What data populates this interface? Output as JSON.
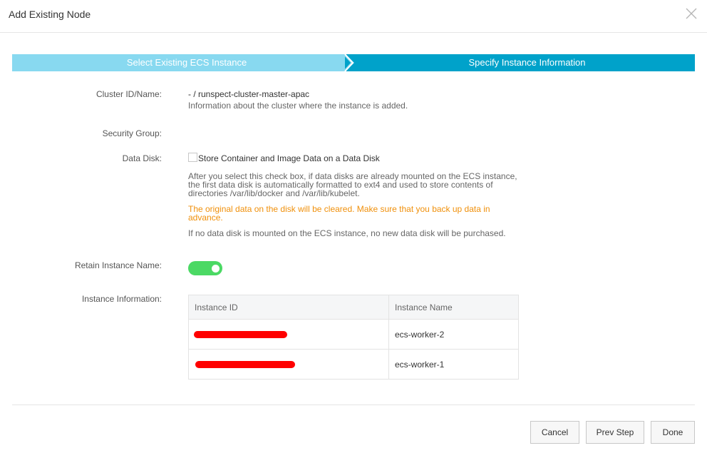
{
  "dialog": {
    "title": "Add Existing Node",
    "close_icon": "close-icon"
  },
  "steps": [
    {
      "label": "Select Existing ECS Instance",
      "state": "done"
    },
    {
      "label": "Specify Instance Information",
      "state": "active"
    }
  ],
  "form": {
    "cluster": {
      "label": "Cluster ID/Name:",
      "value": "- / runspect-cluster-master-apac",
      "description": "Information about the cluster where the instance is added."
    },
    "security_group": {
      "label": "Security Group:"
    },
    "data_disk": {
      "label": "Data Disk:",
      "checkbox_label": "Store Container and Image Data on a Data Disk",
      "checked": false,
      "help_line1": "After you select this check box, if data disks are already mounted on the ECS instance,",
      "help_line2": "the first data disk is automatically formatted to ext4 and used to store contents of",
      "help_line3": "directories /var/lib/docker and /var/lib/kubelet.",
      "warning_line1": "The original data on the disk will be cleared. Make sure that you back up data in",
      "warning_line2": "advance.",
      "note": "If no data disk is mounted on the ECS instance, no new data disk will be purchased."
    },
    "retain_name": {
      "label": "Retain Instance Name:",
      "enabled": true
    },
    "instances": {
      "label": "Instance Information:",
      "columns": [
        "Instance ID",
        "Instance Name"
      ],
      "rows": [
        {
          "id": "",
          "name": "ecs-worker-2"
        },
        {
          "id": "",
          "name": "ecs-worker-1"
        }
      ]
    }
  },
  "buttons": {
    "cancel": "Cancel",
    "prev": "Prev Step",
    "done": "Done"
  },
  "colors": {
    "step_done": "#88d9f0",
    "step_active": "#00a2ca",
    "toggle_on": "#4bd964",
    "warning": "#f0900b",
    "redaction": "#ff0000"
  }
}
